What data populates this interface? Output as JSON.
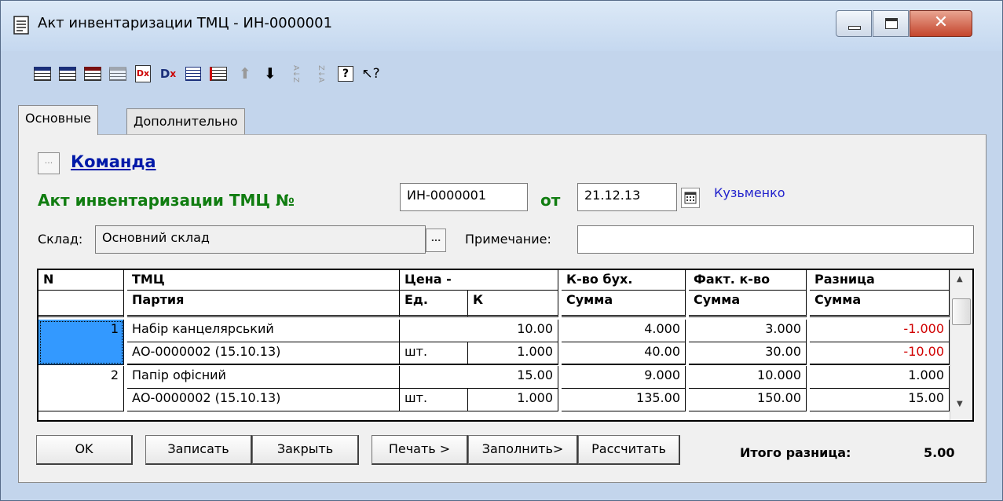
{
  "window": {
    "title": "Акт инвентаризации ТМЦ - ИН-0000001",
    "close_glyph": "✕"
  },
  "toolbar": {
    "icons": [
      "new-row-icon",
      "add-row-icon",
      "delete-row-icon",
      "copy-row-icon",
      "delete-doc-icon",
      "delete-mark-icon",
      "edit-icon",
      "insert-icon",
      "move-up-icon",
      "move-down-icon",
      "sort-asc-icon",
      "sort-desc-icon",
      "help-icon",
      "context-help-icon"
    ],
    "glyphs": {
      "up": "⬆",
      "down": "⬇",
      "sort_asc": "A↓Z",
      "sort_desc": "Z↓A",
      "help": "?",
      "context_help": "↖?"
    }
  },
  "tabs": [
    "Основные",
    "Дополнительно"
  ],
  "header": {
    "command_button": "...",
    "command_link": "Команда",
    "doc_title": "Акт инвентаризации ТМЦ №",
    "doc_number": "ИН-0000001",
    "date_label": "от",
    "date_value": "21.12.13",
    "author": "Кузьменко",
    "warehouse_label": "Склад:",
    "warehouse_value": "Основний склад",
    "warehouse_button": "...",
    "note_label": "Примечание:",
    "note_value": ""
  },
  "table": {
    "headers_row1": [
      "N",
      "ТМЦ",
      "Цена -",
      "К-во бух.",
      "Факт. к-во",
      "Разница"
    ],
    "headers_row2": [
      "Партия",
      "Ед.",
      "К",
      "Сумма",
      "Сумма",
      "Сумма"
    ],
    "rows": [
      {
        "n": "1",
        "name": "Набір канцелярський",
        "price": "10.00",
        "qty_book": "4.000",
        "qty_fact": "3.000",
        "diff": "-1.000",
        "batch": "АО-0000002 (15.10.13)",
        "unit": "шт.",
        "k": "1.000",
        "sum_book": "40.00",
        "sum_fact": "30.00",
        "sum_diff": "-10.00"
      },
      {
        "n": "2",
        "name": "Папір офісний",
        "price": "15.00",
        "qty_book": "9.000",
        "qty_fact": "10.000",
        "diff": "1.000",
        "batch": "АО-0000002 (15.10.13)",
        "unit": "шт.",
        "k": "1.000",
        "sum_book": "135.00",
        "sum_fact": "150.00",
        "sum_diff": "15.00"
      }
    ],
    "scroll_up": "▲",
    "scroll_down": "▼"
  },
  "buttons": {
    "ok": "OK",
    "save": "Записать",
    "close": "Закрыть",
    "print": "Печать >",
    "fill": "Заполнить>",
    "calc": "Рассчитать"
  },
  "totals": {
    "label": "Итого разница:",
    "value": "5.00"
  }
}
